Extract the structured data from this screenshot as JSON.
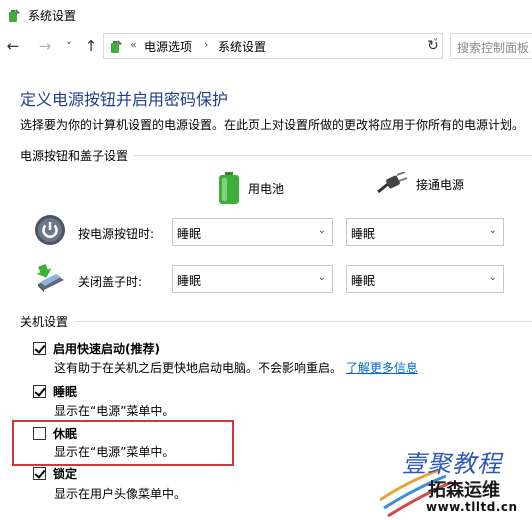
{
  "window": {
    "title": "系统设置"
  },
  "nav": {
    "back": "←",
    "forward": "→",
    "history": "˅",
    "up": "↑",
    "separator": "«",
    "breadcrumbs": [
      "电源选项",
      "系统设置"
    ],
    "crumb_separator": "›",
    "dropdown": "˅",
    "refresh": "↻",
    "search_placeholder": "搜索控制面板"
  },
  "main": {
    "heading": "定义电源按钮并启用密码保护",
    "description": "选择要为你的计算机设置的电源设置。在此页上对设置所做的更改将应用于你所有的电源计划。",
    "power_group": {
      "label": "电源按钮和盖子设置",
      "battery_label": "用电池",
      "plugged_label": "接通电源",
      "rows": [
        {
          "label": "按电源按钮时:",
          "battery": "睡眠",
          "plugged": "睡眠",
          "icon": "power-button-icon"
        },
        {
          "label": "关闭盖子时:",
          "battery": "睡眠",
          "plugged": "睡眠",
          "icon": "laptop-lid-icon"
        }
      ],
      "chevron": "⌄"
    },
    "shutdown_group": {
      "label": "关机设置",
      "options": [
        {
          "title": "启用快速启动(推荐)",
          "desc": "这有助于在关机之后更快地启动电脑。不会影响重启。",
          "link": "了解更多信息",
          "checked": true
        },
        {
          "title": "睡眠",
          "desc": "显示在“电源”菜单中。",
          "checked": true
        },
        {
          "title": "休眠",
          "desc": "显示在“电源”菜单中。",
          "checked": false
        },
        {
          "title": "锁定",
          "desc": "显示在用户头像菜单中。",
          "checked": true
        }
      ]
    }
  },
  "watermark": {
    "line1": "壹聚教程",
    "line2": "拓森运维",
    "line3": "www.tlltd.cn"
  },
  "colors": {
    "heading": "#1e3e8f",
    "link": "#0066cc",
    "highlight": "#d0383a",
    "battery": "#3fae3a"
  }
}
